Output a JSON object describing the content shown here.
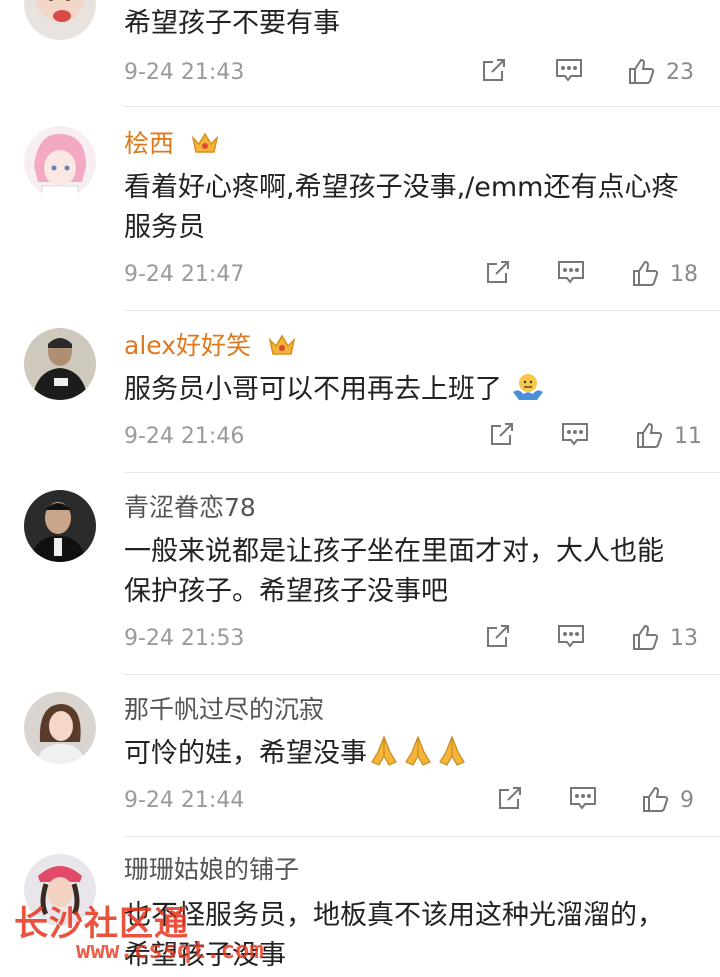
{
  "comments": [
    {
      "text": "希望孩子不要有事",
      "time": "9-24 21:43",
      "likes": "23"
    },
    {
      "user": "桧西",
      "text": "看着好心疼啊,希望孩子没事,/emm还有点心疼服务员",
      "time": "9-24 21:47",
      "likes": "18"
    },
    {
      "user": "alex好好笑",
      "text": "服务员小哥可以不用再去上班了",
      "time": "9-24 21:46",
      "likes": "11"
    },
    {
      "user": "青涩眷恋78",
      "text": "一般来说都是让孩子坐在里面才对，大人也能保护孩子。希望孩子没事吧",
      "time": "9-24 21:53",
      "likes": "13"
    },
    {
      "user": "那千帆过尽的沉寂",
      "text": "可怜的娃，希望没事",
      "time": "9-24 21:44",
      "likes": "9"
    },
    {
      "user": "珊珊姑娘的铺子",
      "text": "也不怪服务员，地板真不该用这种光溜溜的，希望孩子没事"
    }
  ],
  "watermark": {
    "name": "长沙社区通",
    "url": "www.cssqt.com"
  },
  "colors": {
    "vip_name": "#e0781e",
    "time": "#9a9a9a",
    "divider": "#e8e8e8",
    "watermark": "#e8341c"
  },
  "icons": [
    "share-icon",
    "comment-icon",
    "like-icon",
    "crown-icon",
    "shrug-emoji",
    "pray-emoji"
  ]
}
